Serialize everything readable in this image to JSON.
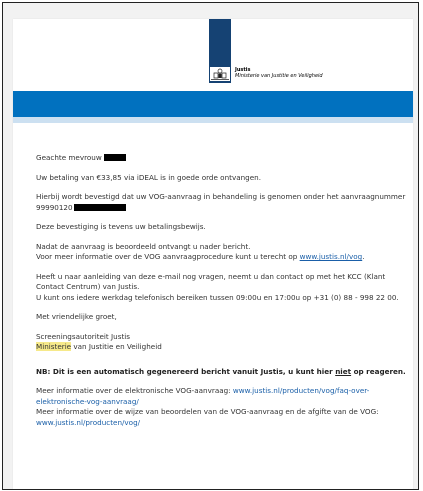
{
  "header": {
    "org_name": "Justis",
    "org_subtitle": "Ministerie van Justitie en Veiligheid",
    "crest_icon": "dutch-government-crest-icon",
    "banner_color": "#0171bf",
    "logo_color": "#154273"
  },
  "email": {
    "greeting": "Geachte mevrouw",
    "payment": "Uw betaling van €33,85 via iDEAL is in goede orde ontvangen.",
    "confirmation": "Hierbij wordt bevestigd dat uw VOG-aanvraag in behandeling is genomen onder het aanvraagnummer 99990120",
    "receipt": "Deze bevestiging is tevens uw betalingsbewijs.",
    "notify_line1": "Nadat de aanvraag is beoordeeld ontvangt u nader bericht.",
    "notify_line2": "Voor meer informatie over de VOG aanvraagprocedure kunt u terecht op ",
    "notify_link": "www.justis.nl/vog",
    "notify_end": ".",
    "kcc_part1": "Heeft u naar aanleiding van deze e-mail nog vragen, neemt u dan contact op met het KCC (Klant Contact Centrum) van Justis.",
    "kcc_part2": "U kunt ons iedere werkdag telefonisch bereiken tussen 09:00u en 17:00u op +31 (0) 88 - 998 22 00.",
    "closing": "Met vriendelijke groet,",
    "sig_line1": "Screeningsautoriteit Justis",
    "sig_line2_highlight": "Ministerie",
    "sig_line2_rest": " van Justitie en Veiligheid",
    "nb_pre": "NB: Dit is een automatisch gegenereerd bericht vanuit Justis, u kunt hier ",
    "nb_niet": "niet",
    "nb_post": " op reageren.",
    "faq_text": "Meer informatie over de elektronische VOG-aanvraag: ",
    "faq_link": "www.justis.nl/producten/vog/faq-over-elektronische-vog-aanvraag/",
    "assess_text": "Meer informatie over de wijze van beoordelen van de VOG-aanvraag en de afgifte van de VOG: ",
    "assess_link": "www.justis.nl/producten/vog/"
  }
}
